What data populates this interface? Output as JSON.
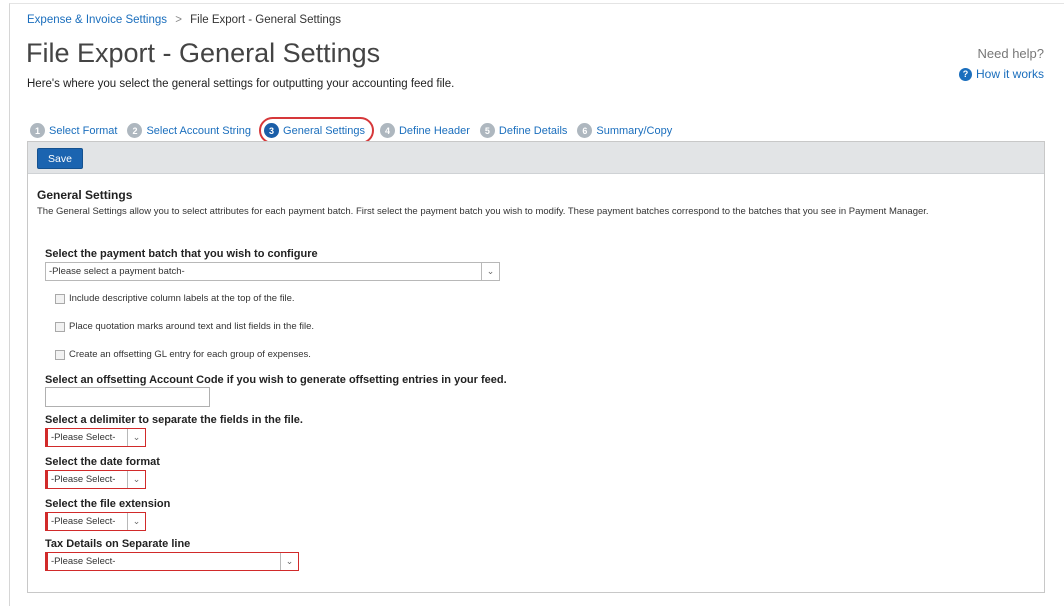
{
  "breadcrumb": {
    "parent": "Expense & Invoice Settings",
    "separator": ">",
    "current": "File Export - General Settings"
  },
  "page": {
    "title": "File Export - General Settings",
    "subtitle": "Here's where you select the general settings for outputting your accounting feed file."
  },
  "help": {
    "need_help": "Need help?",
    "how_it_works": "How it works",
    "icon": "question-icon"
  },
  "steps": [
    {
      "num": "1",
      "label": "Select Format"
    },
    {
      "num": "2",
      "label": "Select Account String"
    },
    {
      "num": "3",
      "label": "General Settings"
    },
    {
      "num": "4",
      "label": "Define Header"
    },
    {
      "num": "5",
      "label": "Define Details"
    },
    {
      "num": "6",
      "label": "Summary/Copy"
    }
  ],
  "toolbar": {
    "save_label": "Save"
  },
  "section": {
    "title": "General Settings",
    "description": "The General Settings allow you to select attributes for each payment batch. First select the payment batch you wish to modify. These payment batches correspond to the batches that you see in Payment Manager."
  },
  "form": {
    "batch": {
      "label": "Select the payment batch that you wish to configure",
      "value": "-Please select a payment batch-"
    },
    "checkboxes": [
      "Include descriptive column labels at the top of the file.",
      "Place quotation marks around text and list fields in the file.",
      "Create an offsetting GL entry for each group of expenses."
    ],
    "offset_account": {
      "label": "Select an offsetting Account Code if you wish to generate offsetting entries in your feed.",
      "value": ""
    },
    "delimiter": {
      "label": "Select a delimiter to separate the fields in the file.",
      "value": "-Please Select-"
    },
    "date_format": {
      "label": "Select the date format",
      "value": "-Please Select-"
    },
    "file_extension": {
      "label": "Select the file extension",
      "value": "-Please Select-"
    },
    "tax_details": {
      "label": "Tax Details on Separate line",
      "value": "-Please Select-"
    }
  },
  "colors": {
    "link": "#1a6ebd",
    "primary_button": "#1b64b0",
    "required_border": "#d12a2a",
    "active_step_ring": "#d6383a"
  }
}
